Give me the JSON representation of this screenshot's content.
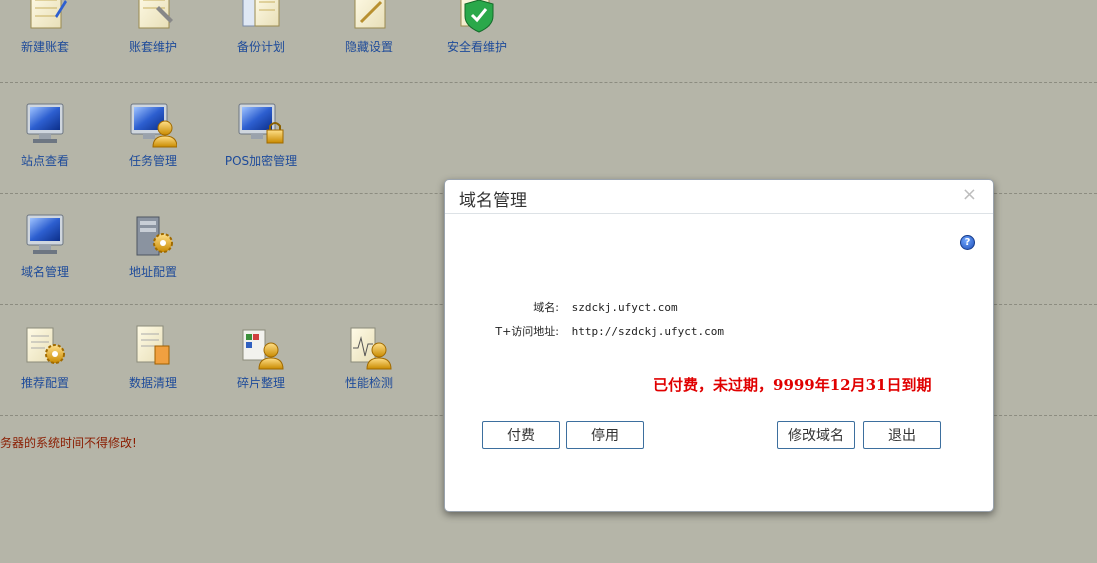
{
  "menu": {
    "row1": [
      {
        "label": "新建账套",
        "icon": "new-book-icon"
      },
      {
        "label": "账套维护",
        "icon": "book-maintenance-icon"
      },
      {
        "label": "备份计划",
        "icon": "backup-plan-icon"
      },
      {
        "label": "隐藏设置",
        "icon": "hide-settings-icon"
      },
      {
        "label": "安全看维护",
        "icon": "security-shield-icon"
      }
    ],
    "row2": [
      {
        "label": "站点查看",
        "icon": "monitor-icon"
      },
      {
        "label": "任务管理",
        "icon": "monitor-user-icon"
      },
      {
        "label": "POS加密管理",
        "icon": "monitor-lock-icon"
      }
    ],
    "row3": [
      {
        "label": "域名管理",
        "icon": "monitor-icon"
      },
      {
        "label": "地址配置",
        "icon": "server-gear-icon"
      }
    ],
    "row4": [
      {
        "label": "推荐配置",
        "icon": "document-gear-icon"
      },
      {
        "label": "数据清理",
        "icon": "document-clean-icon"
      },
      {
        "label": "碎片整理",
        "icon": "defrag-user-icon"
      },
      {
        "label": "性能检测",
        "icon": "performance-user-icon"
      }
    ]
  },
  "warning": "务器的系统时间不得修改!",
  "dialog": {
    "title": "域名管理",
    "close": "×",
    "help": "?",
    "domain_label": "域名:",
    "domain_value": "szdckj.ufyct.com",
    "url_label": "T+访问地址:",
    "url_value": "http://szdckj.ufyct.com",
    "status": "已付费，未过期，9999年12月31日到期",
    "buttons": {
      "pay": "付费",
      "disable": "停用",
      "modify": "修改域名",
      "exit": "退出"
    }
  },
  "colors": {
    "background": "#b5b5a8",
    "link": "#1e4b9a",
    "status": "#e00000",
    "warning": "#8a1c00"
  }
}
